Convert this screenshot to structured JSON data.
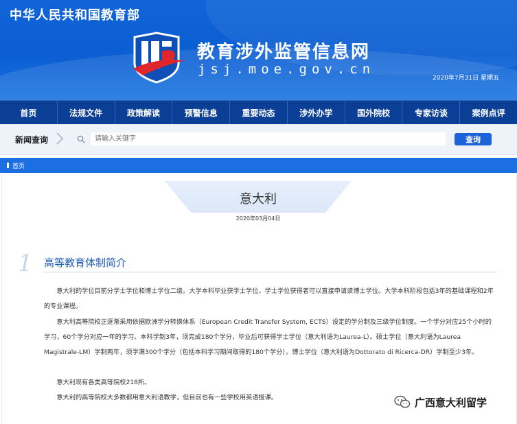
{
  "header": {
    "ministry": "中华人民共和国教育部",
    "site_title": "教育涉外监管信息网",
    "site_url": "jsj.moe.gov.cn",
    "date": "2020年7月31日  星期五"
  },
  "nav": {
    "items": [
      "首页",
      "法规文件",
      "政策解读",
      "预警信息",
      "重要动态",
      "涉外办学",
      "国外院校",
      "专家访谈",
      "案例点评"
    ]
  },
  "search": {
    "label": "新闻查询",
    "placeholder": "请输入关键字",
    "button": "查询"
  },
  "breadcrumb": {
    "home": "首页"
  },
  "article": {
    "title": "意大利",
    "date": "2020年03月04日",
    "section_number": "1",
    "section_title": "高等教育体制简介",
    "paragraphs": [
      "意大利的学位目前分学士学位和博士学位二级。大学本科毕业获学士学位，学士学位获得者可以直接申请读博士学位。大学本科阶段包括3年的基础课程和2年的专业课程。",
      "意大利高等院校正逐渐采用依据欧洲学分转换体系（European Credit Transfer System, ECTS）设定的学分制及三级学位制度。一个学分对应25个小时的学习，60个学分对应一年的学习。本科学制3年，须完成180个学分，毕业后可获得学士学位（意大利语为Laurea-L）。硕士学位（意大利语为Laurea Magistrale-LM）学制两年，须学满300个学分（包括本科学习期间取得的180个学分）。博士学位（意大利语为Dottorato di Ricerca-DR）学制至少3年。",
      "意大利现有各类高等院校218所。",
      "意大利的高等院校大多数都用意大利语教学，但目前也有一些学校用英语授课。"
    ]
  },
  "watermark": {
    "text": "广西意大利留学"
  },
  "colors": {
    "banner": "#0b5ed3",
    "nav": "#0a3f95",
    "accent": "#1b63d6",
    "section_title": "#1f5cb5"
  },
  "icons": [
    "ministry-logo",
    "chevron-right-icon",
    "search-icon",
    "wechat-icon"
  ]
}
